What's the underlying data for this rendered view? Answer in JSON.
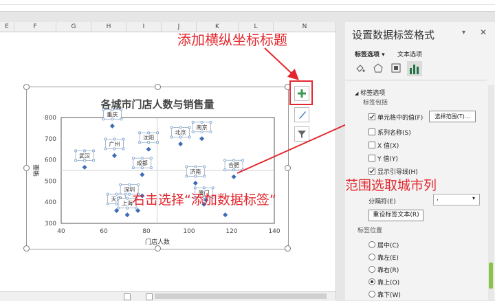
{
  "columns": [
    "E",
    "F",
    "G",
    "H",
    "I",
    "J",
    "K",
    "L",
    "N"
  ],
  "chart": {
    "title": "各城市门店人数与销售量",
    "xlabel": "门店人数",
    "ylabel": "销量"
  },
  "chart_data": {
    "type": "scatter",
    "title": "各城市门店人数与销售量",
    "xlabel": "门店人数",
    "ylabel": "销量",
    "xlim": [
      40,
      140
    ],
    "ylim": [
      300,
      800
    ],
    "xticks": [
      40,
      60,
      80,
      100,
      120,
      140
    ],
    "yticks": [
      300,
      400,
      500,
      600,
      700,
      800
    ],
    "points": [
      {
        "label": "重庆",
        "x": 64,
        "y": 760
      },
      {
        "label": "广州",
        "x": 65,
        "y": 620
      },
      {
        "label": "武汉",
        "x": 51,
        "y": 565
      },
      {
        "label": "沈阳",
        "x": 81,
        "y": 650
      },
      {
        "label": "北京",
        "x": 96,
        "y": 675
      },
      {
        "label": "南京",
        "x": 106,
        "y": 700
      },
      {
        "label": "成都",
        "x": 78,
        "y": 530
      },
      {
        "label": "济南",
        "x": 103,
        "y": 490
      },
      {
        "label": "合肥",
        "x": 121,
        "y": 520
      },
      {
        "label": "深圳",
        "x": 72,
        "y": 405
      },
      {
        "label": "",
        "x": 78,
        "y": 430
      },
      {
        "label": "",
        "x": 104,
        "y": 450
      },
      {
        "label": "",
        "x": 108,
        "y": 410
      },
      {
        "label": "厦门",
        "x": 107,
        "y": 390
      },
      {
        "label": "",
        "x": 117,
        "y": 340
      },
      {
        "label": "天津",
        "x": 66,
        "y": 360
      },
      {
        "label": "",
        "x": 68,
        "y": 385
      },
      {
        "label": "上海",
        "x": 71,
        "y": 340
      },
      {
        "label": "",
        "x": 76,
        "y": 360
      }
    ],
    "grid": true,
    "marker_color": "#3d6db5"
  },
  "panel": {
    "title": "设置数据标签格式",
    "tabs": [
      "标签选项",
      "文本选项"
    ],
    "section": "标签选项",
    "contains_label": "标签包括",
    "checkboxes": [
      {
        "label": "单元格中的值(F)",
        "checked": true
      },
      {
        "label": "系列名称(S)",
        "checked": false
      },
      {
        "label": "X 值(X)",
        "checked": false
      },
      {
        "label": "Y 值(Y)",
        "checked": false
      },
      {
        "label": "显示引导线(H)",
        "checked": true
      }
    ],
    "select_range_button": "选择范围(T)...",
    "separator_label": "分隔符(E)",
    "separator_value": ",",
    "reset_button": "重设标签文本(R)",
    "position_label": "标签位置",
    "positions": [
      {
        "label": "居中(C)",
        "selected": false
      },
      {
        "label": "靠左(E)",
        "selected": false
      },
      {
        "label": "靠右(R)",
        "selected": false
      },
      {
        "label": "靠上(O)",
        "selected": true
      },
      {
        "label": "靠下(W)",
        "selected": false
      }
    ]
  },
  "annotations": {
    "axis_titles": "添加横纵坐标标题",
    "right_click": "右击选择“添加数据标签”",
    "range": "范围选取城市列"
  },
  "colors": {
    "annotation_red": "#e3262c",
    "panel_accent": "#217346",
    "marker": "#3d6db5"
  }
}
